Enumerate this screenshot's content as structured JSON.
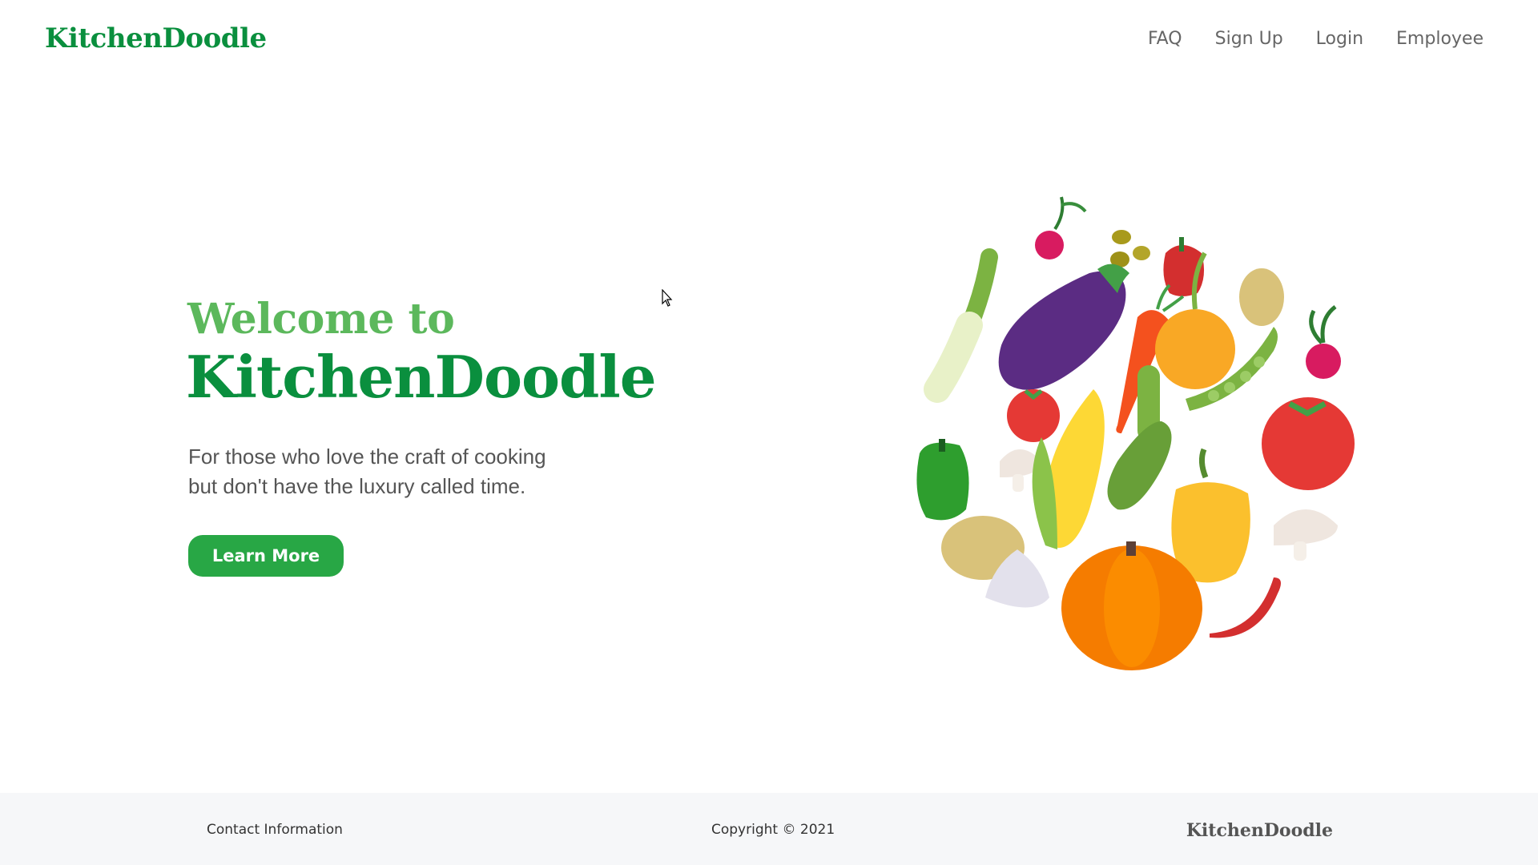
{
  "header": {
    "brand": "KitchenDoodle",
    "nav": [
      {
        "label": "FAQ"
      },
      {
        "label": "Sign Up"
      },
      {
        "label": "Login"
      },
      {
        "label": "Employee"
      }
    ]
  },
  "hero": {
    "welcome": "Welcome to",
    "title": "KitchenDoodle",
    "subtitle_lines": [
      "For those who love the craft of cooking",
      "but don't have the luxury called time."
    ],
    "cta_label": "Learn More",
    "illustration": "vegetables-circle-illustration"
  },
  "footer": {
    "contact": "Contact Information",
    "copyright": "Copyright © 2021",
    "brand": "KitchenDoodle"
  },
  "colors": {
    "brand_green": "#0a8f3e",
    "welcome_green": "#5cb85c",
    "button_green": "#28a745",
    "nav_text": "#666666",
    "footer_bg": "#f6f7f9"
  }
}
